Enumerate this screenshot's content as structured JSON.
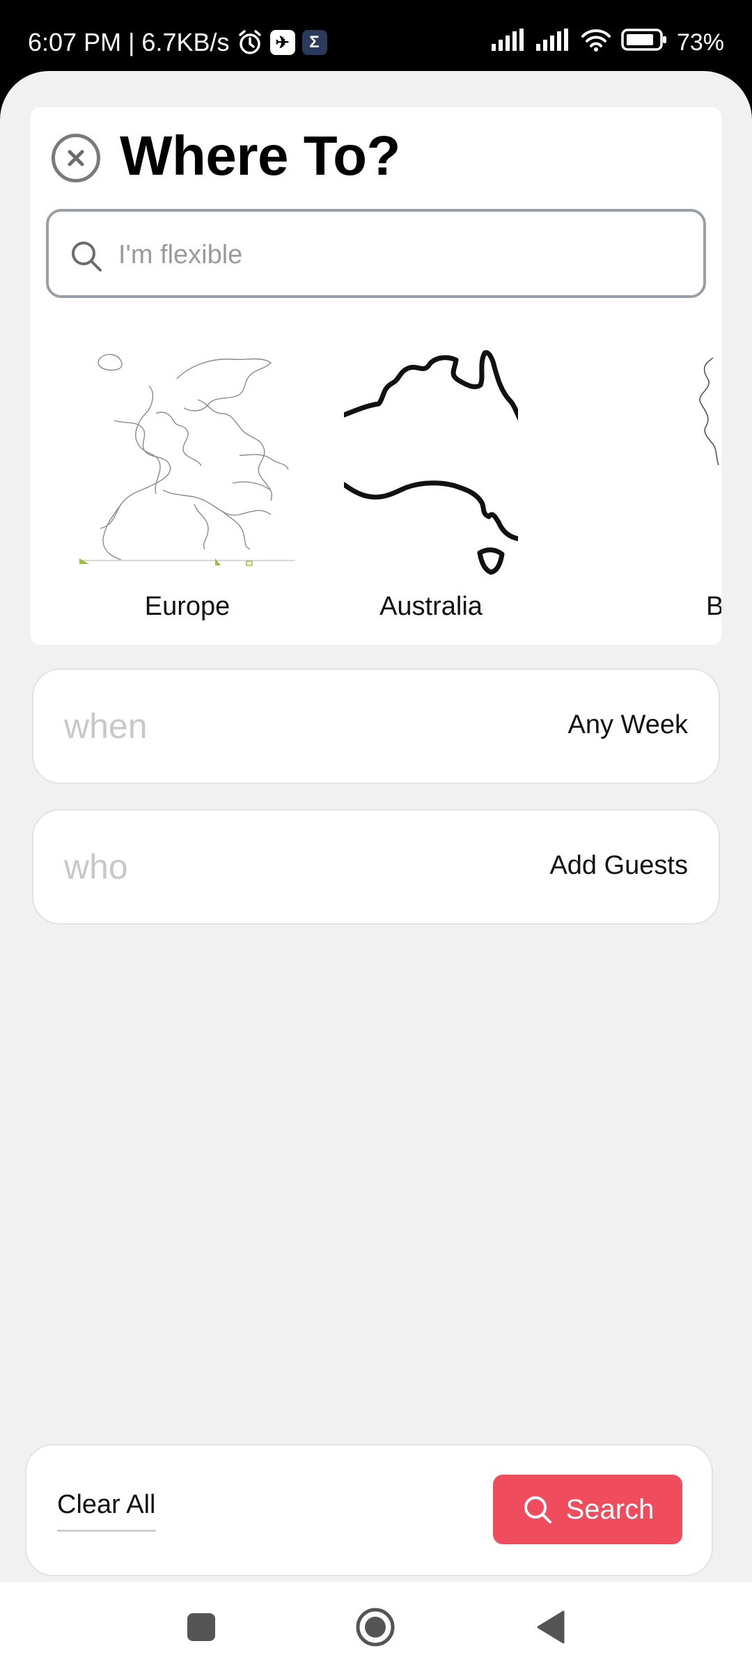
{
  "status_bar": {
    "time_speed": "6:07 PM | 6.7KB/s",
    "battery": "73%",
    "icons": [
      "alarm-icon",
      "app-icon",
      "sigma-app-icon",
      "signal-icon",
      "signal-icon",
      "wifi-icon",
      "battery-icon"
    ]
  },
  "where": {
    "title": "Where To?",
    "search_placeholder": "I'm flexible",
    "regions": [
      {
        "label": "Europe"
      },
      {
        "label": "Australia"
      },
      {
        "label": "Ba"
      }
    ]
  },
  "when": {
    "key": "when",
    "value": "Any Week"
  },
  "who": {
    "key": "who",
    "value": "Add Guests"
  },
  "footer": {
    "clear_label": "Clear All",
    "search_label": "Search",
    "accent": "#ef4d5e"
  },
  "navbar": {
    "icons": [
      "recents-icon",
      "home-icon",
      "back-icon"
    ]
  }
}
